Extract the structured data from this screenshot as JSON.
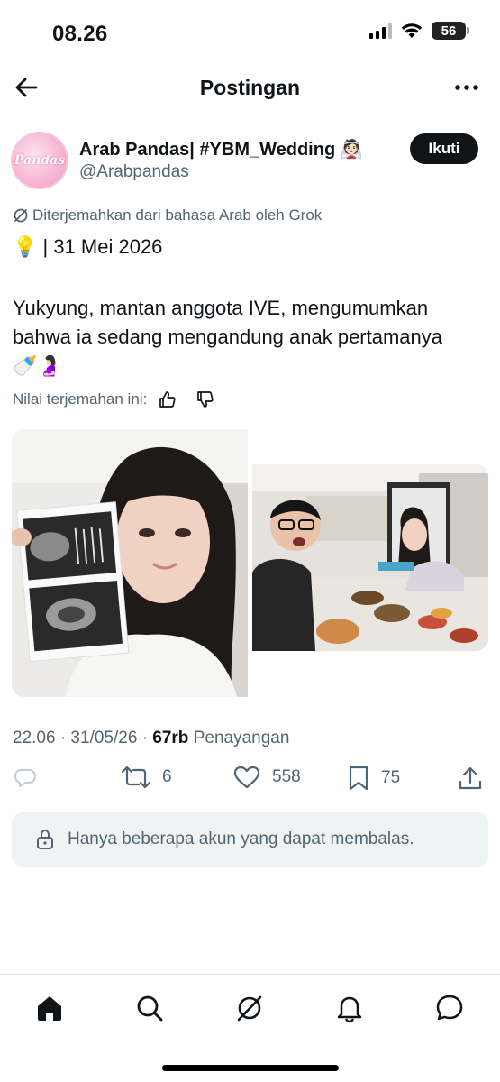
{
  "status_bar": {
    "time": "08.26",
    "battery": "56"
  },
  "header": {
    "title": "Postingan"
  },
  "post": {
    "author_name": "Arab Pandas| #YBM_Wedding 👰🏻",
    "author_handle": "@Arabpandas",
    "avatar_text": "Pandas",
    "follow_label": "Ikuti",
    "translated_note": "Diterjemahkan dari bahasa Arab oleh Grok",
    "line1": "💡 | 31 Mei 2026",
    "body_l1": "Yukyung, mantan anggota IVE, mengumumkan",
    "body_l2": "bahwa ia sedang mengandung anak pertamanya",
    "body_l3": "🍼🤰🏻",
    "rate_label": "Nilai terjemahan ini:",
    "timestamp": "22.06 · 31/05/26 · ",
    "views_count": "67rb",
    "views_label": "Penayangan"
  },
  "actions": {
    "reposts": "6",
    "likes": "558",
    "bookmarks": "75"
  },
  "reply_restriction": "Hanya beberapa akun yang dapat membalas.",
  "images": [
    {
      "icon": "photo-woman-ultrasound"
    },
    {
      "icon": "photo-dinner-table"
    }
  ]
}
